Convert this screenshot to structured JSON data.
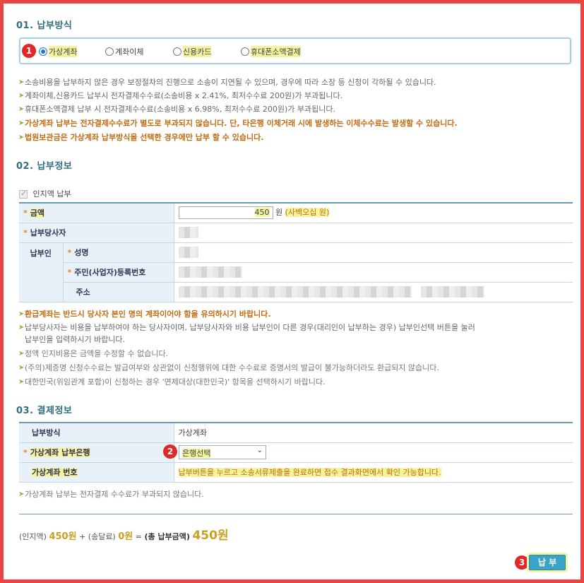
{
  "sections": {
    "s1_title": "01. 납부방식",
    "s2_title": "02. 납부정보",
    "s3_title": "03. 결제정보"
  },
  "payment_methods": [
    {
      "label": "가상계좌",
      "selected": true
    },
    {
      "label": "계좌이체",
      "selected": false
    },
    {
      "label": "신용카드",
      "selected": false
    },
    {
      "label": "휴대폰소액결제",
      "selected": false
    }
  ],
  "badges": [
    "1",
    "2",
    "3"
  ],
  "notes1": [
    "소송비용을 납부하지 않은 경우 보정절차의 진행으로 소송이 지연될 수 있으며, 경우에 따라 소장 등 신청이 각하될 수 있습니다.",
    "계좌이체,신용카드 납부시 전자결제수수료(소송비용 x 2.41%, 최저수수료 200원)가 부과됩니다.",
    "휴대폰소액결제 납부 시 전자결제수수료(소송비용 x 6.98%, 최저수수료 200원)가 부과됩니다.",
    "가상계좌 납부는 전자결제수수료가 별도로 부과되지 않습니다. 단, 타은행 이체거래 시에 발생하는 이체수수료는 발생할 수 있습니다.",
    "법원보관금은 가상계좌 납부방식을 선택한 경우에만 납부 할 수 있습니다."
  ],
  "stamp_checkbox_label": "인지액 납부",
  "info_table": {
    "amount_label": "금액",
    "amount_value": "450",
    "amount_unit": "원",
    "amount_korean": "(사백오십 원)",
    "party_label": "납부당사자",
    "payer_label": "납부인",
    "name_label": "성명",
    "id_label": "주민(사업자)등록번호",
    "address_label": "주소"
  },
  "notes2": [
    "환급계좌는 반드시 당사자 본인 명의 계좌이어야 함을 유의하시기 바랍니다.",
    "납부당사자는 비용을 납부하여야 하는 당사자이며, 납부당사자와 비용 납부인이 다른 경우(대리인이 납부하는 경우) 납부인선택 버튼을 눌러",
    "납부인을 입력하시기 바랍니다.",
    "정액 인지비용은 금액을 수정할 수 없습니다.",
    "(주의)제증명 신청수수료는 발급여부와 상관없이 신청행위에 대한 수수료로 증명서의 발급이 불가능하더라도 환급되지 않습니다.",
    "대한민국(위임관계 포함)이 신청하는 경우 '면제대상(대한민국)' 항목을 선택하시기 바랍니다."
  ],
  "payment_table": {
    "method_label": "납부방식",
    "method_value": "가상계좌",
    "bank_label": "가상계좌 납부은행",
    "bank_select": "은행선택",
    "account_label": "가상계좌 번호",
    "account_value": "납부버튼을 누르고 소송서류제출을 완료하면 접수 결과화면에서 확인 가능합니다."
  },
  "note3": "가상계좌 납부는 전자결제 수수료가 부과되지 않습니다.",
  "summary": {
    "stamp_label": "(인지액)",
    "stamp_amount": "450원",
    "plus": "+",
    "delivery_label": "(송달료)",
    "delivery_amount": "0원",
    "equals": "=",
    "total_label": "(총 납부금액)",
    "total_amount": "450원"
  },
  "submit_label": "납 부",
  "colors": {
    "frame": "#e84545",
    "title": "#2f6f7e",
    "highlight": "#f4f3a0",
    "accent": "#1a73d9"
  }
}
